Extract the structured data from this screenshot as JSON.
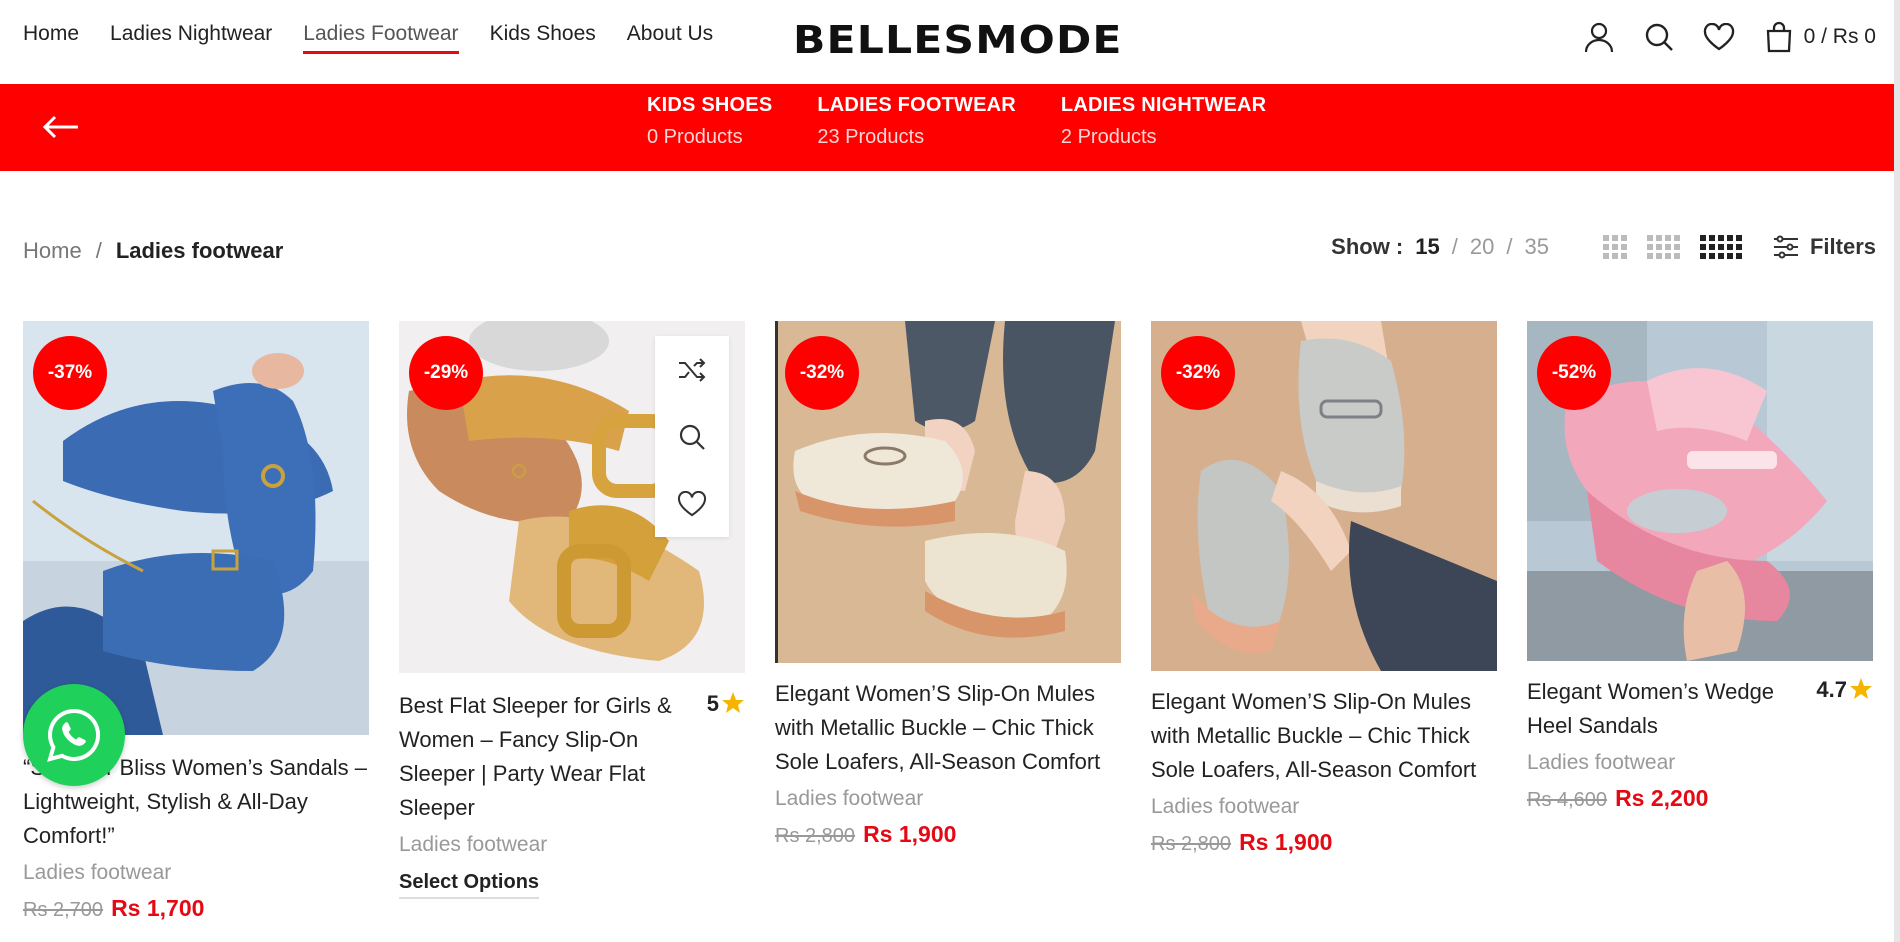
{
  "nav": {
    "items": [
      "Home",
      "Ladies Nightwear",
      "Ladies Footwear",
      "Kids Shoes",
      "About Us"
    ],
    "active": "Ladies Footwear"
  },
  "logo": "BELLESMODE",
  "cart": {
    "text": "0 / Rs 0"
  },
  "icons": {
    "account": "user-icon",
    "search": "search-icon",
    "wishlist": "heart-icon",
    "cart": "shopping-bag-icon",
    "back": "arrow-left-icon"
  },
  "categories": [
    {
      "name": "KIDS SHOES",
      "count": "0 Products"
    },
    {
      "name": "LADIES FOOTWEAR",
      "count": "23 Products"
    },
    {
      "name": "LADIES NIGHTWEAR",
      "count": "2 Products"
    }
  ],
  "breadcrumb": {
    "home": "Home",
    "separator": "/",
    "current": "Ladies footwear"
  },
  "toolbar": {
    "show_label": "Show :",
    "per_page": [
      "15",
      "20",
      "35"
    ],
    "active_per_page": "15",
    "filters_label": "Filters"
  },
  "products": [
    {
      "badge": "-37%",
      "title": "“Summer Bliss Women’s Sandals – Lightweight, Stylish & All-Day Comfort!”",
      "rating": "",
      "category": "Ladies footwear",
      "old_price": "Rs 2,700",
      "new_price": "Rs 1,700",
      "action": ""
    },
    {
      "badge": "-29%",
      "title": "Best Flat Sleeper for Girls & Women – Fancy Slip-On Sleeper | Party Wear Flat Sleeper",
      "rating": "5",
      "category": "Ladies footwear",
      "old_price": "",
      "new_price": "",
      "action": "Select Options"
    },
    {
      "badge": "-32%",
      "title": "Elegant Women’S Slip-On Mules with Metallic Buckle – Chic Thick Sole Loafers, All-Season Comfort",
      "rating": "",
      "category": "Ladies footwear",
      "old_price": "Rs 2,800",
      "new_price": "Rs 1,900",
      "action": ""
    },
    {
      "badge": "-32%",
      "title": "Elegant Women’S Slip-On Mules with Metallic Buckle – Chic Thick Sole Loafers, All-Season Comfort",
      "rating": "",
      "category": "Ladies footwear",
      "old_price": "Rs 2,800",
      "new_price": "Rs 1,900",
      "action": ""
    },
    {
      "badge": "-52%",
      "title": "Elegant Women’s Wedge Heel Sandals",
      "rating": "4.7",
      "category": "Ladies footwear",
      "old_price": "Rs 4,600",
      "new_price": "Rs 2,200",
      "action": ""
    }
  ],
  "colors": {
    "accent": "#ff0000",
    "whatsapp": "#1fd15a"
  }
}
